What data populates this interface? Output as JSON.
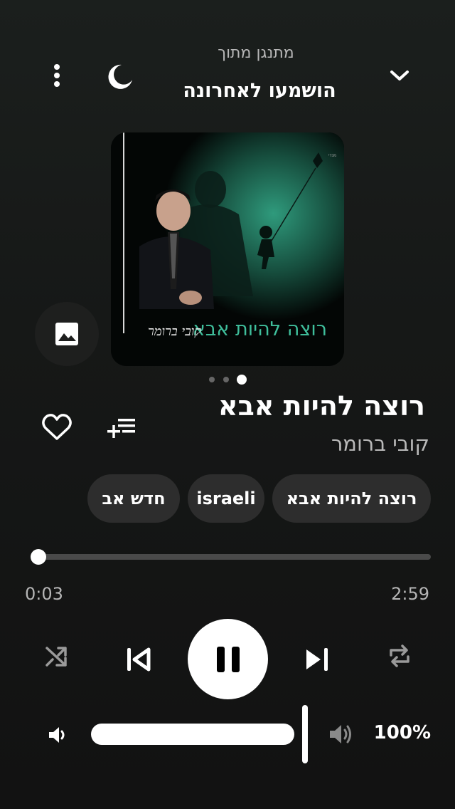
{
  "header": {
    "subtitle": "מתנגן מתוך",
    "title": "הושמעו לאחרונה"
  },
  "icons": {
    "more": "more-vert-icon",
    "sleep": "moon-icon",
    "collapse": "chevron-down-icon",
    "image": "image-icon",
    "favorite": "heart-outline-icon",
    "add_to_queue": "playlist-add-icon",
    "shuffle": "shuffle-icon",
    "previous": "skip-previous-icon",
    "pause": "pause-icon",
    "next": "skip-next-icon",
    "repeat": "repeat-icon",
    "volume_low": "volume-low-icon",
    "volume_high": "volume-high-icon"
  },
  "album": {
    "title_text": "רוצה להיות אבא",
    "artist_text": "קובי ברומר"
  },
  "pager": {
    "count": 3,
    "active_index": 2
  },
  "track": {
    "name": "רוצה להיות אבא",
    "artist": "קובי ברומר"
  },
  "tags": [
    "רוצה להיות אבא",
    "israeli",
    "חדש אב"
  ],
  "progress": {
    "current": "0:03",
    "total": "2:59",
    "fraction": 0.017
  },
  "volume": {
    "label": "100%",
    "level": 1.0
  },
  "colors": {
    "accent_album_text": "#3fbf9c",
    "background": "#161817",
    "chip_bg": "#2d2d2d"
  }
}
